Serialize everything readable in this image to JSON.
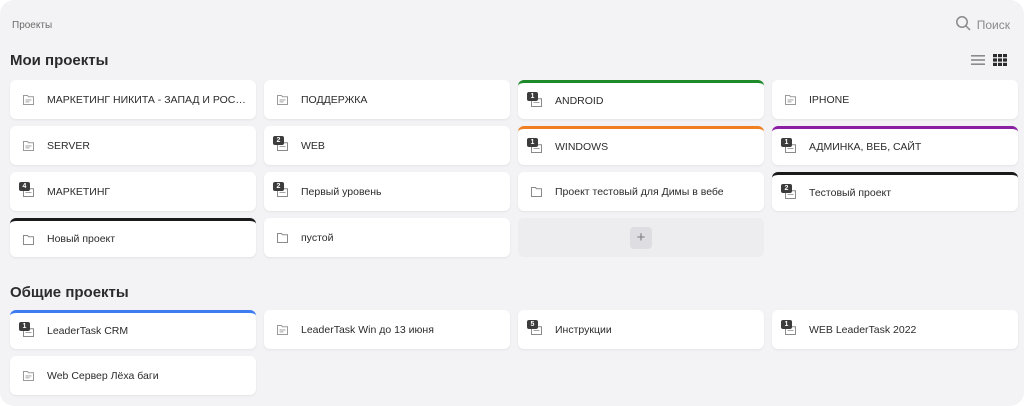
{
  "breadcrumb": "Проекты",
  "search": {
    "label": "Поиск"
  },
  "view_toggle": {
    "list_icon": "list-icon",
    "grid_icon": "grid-icon"
  },
  "my_projects": {
    "title": "Мои проекты",
    "items": [
      {
        "name": "МАРКЕТИНГ НИКИТА - ЗАПАД И РОССИЯ",
        "icon": "project-file-icon",
        "badge": "",
        "color": ""
      },
      {
        "name": "ПОДДЕРЖКА",
        "icon": "project-file-icon",
        "badge": "",
        "color": ""
      },
      {
        "name": "ANDROID",
        "icon": "shared-project-icon",
        "badge": "1",
        "color": "#1f8a2a"
      },
      {
        "name": "IPHONE",
        "icon": "project-file-icon",
        "badge": "",
        "color": ""
      },
      {
        "name": "SERVER",
        "icon": "project-file-icon",
        "badge": "",
        "color": ""
      },
      {
        "name": "WEB",
        "icon": "shared-project-icon",
        "badge": "2",
        "color": ""
      },
      {
        "name": "WINDOWS",
        "icon": "shared-project-icon",
        "badge": "1",
        "color": "#f07f22"
      },
      {
        "name": "АДМИНКА, ВЕБ, САЙТ",
        "icon": "shared-project-icon",
        "badge": "1",
        "color": "#8b1fa3"
      },
      {
        "name": "МАРКЕТИНГ",
        "icon": "shared-project-icon",
        "badge": "4",
        "color": ""
      },
      {
        "name": "Первый уровень",
        "icon": "shared-project-icon",
        "badge": "2",
        "color": ""
      },
      {
        "name": "Проект тестовый для Димы в вебе",
        "icon": "folder-icon",
        "badge": "",
        "color": ""
      },
      {
        "name": "Тестовый проект",
        "icon": "shared-project-icon",
        "badge": "2",
        "color": "#1a1a1a"
      },
      {
        "name": "Новый проект",
        "icon": "folder-icon",
        "badge": "",
        "color": "#1a1a1a"
      },
      {
        "name": "пустой",
        "icon": "folder-icon",
        "badge": "",
        "color": ""
      }
    ],
    "add_label": "+"
  },
  "shared_projects": {
    "title": "Общие проекты",
    "items": [
      {
        "name": "LeaderTask CRM",
        "icon": "shared-project-icon",
        "badge": "1",
        "color": "#3d7bf2"
      },
      {
        "name": "LeaderTask Win до 13 июня",
        "icon": "project-file-icon",
        "badge": "",
        "color": ""
      },
      {
        "name": "Инструкции",
        "icon": "shared-project-icon",
        "badge": "5",
        "color": ""
      },
      {
        "name": "WEB LeaderTask 2022",
        "icon": "shared-project-icon",
        "badge": "1",
        "color": ""
      },
      {
        "name": "Web Сервер Лёха баги",
        "icon": "project-file-icon",
        "badge": "",
        "color": ""
      }
    ]
  }
}
